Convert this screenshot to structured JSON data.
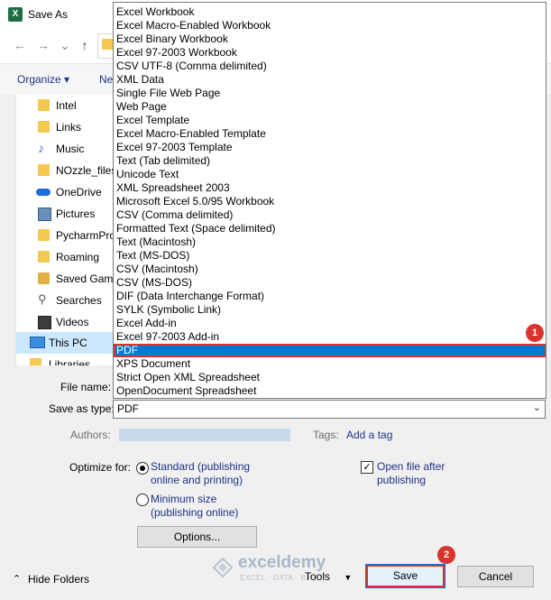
{
  "window": {
    "title": "Save As",
    "app_icon": "X"
  },
  "nav": {
    "back": "←",
    "forward": "→",
    "down": "⌄",
    "up": "↑"
  },
  "toolbar": {
    "organize": "Organize ▾",
    "new_folder": "Ne"
  },
  "sidebar": {
    "items": [
      {
        "label": "Intel",
        "icon": "folder-icon"
      },
      {
        "label": "Links",
        "icon": "link-icon"
      },
      {
        "label": "Music",
        "icon": "music-icon"
      },
      {
        "label": "NOzzle_files",
        "icon": "folder-icon"
      },
      {
        "label": "OneDrive",
        "icon": "cloud-icon"
      },
      {
        "label": "Pictures",
        "icon": "pictures-icon"
      },
      {
        "label": "PycharmPro",
        "icon": "folder-icon"
      },
      {
        "label": "Roaming",
        "icon": "folder-icon"
      },
      {
        "label": "Saved Game",
        "icon": "saved-games-icon"
      },
      {
        "label": "Searches",
        "icon": "search-icon"
      },
      {
        "label": "Videos",
        "icon": "video-icon"
      },
      {
        "label": "This PC",
        "icon": "computer-icon",
        "selected": true
      },
      {
        "label": "Libraries",
        "icon": "libraries-icon"
      }
    ]
  },
  "form": {
    "file_name_label": "File name:",
    "file_name_value": "",
    "save_as_type_label": "Save as type:",
    "save_as_type_value": "PDF",
    "authors_label": "Authors:",
    "tags_label": "Tags:",
    "tags_link": "Add a tag",
    "optimize_label": "Optimize for:",
    "opt_standard_1": "Standard (publishing",
    "opt_standard_2": "online and printing)",
    "opt_minimum_1": "Minimum size",
    "opt_minimum_2": "(publishing online)",
    "open_after_1": "Open file after",
    "open_after_2": "publishing",
    "options_button": "Options..."
  },
  "footer": {
    "hide_folders": "Hide Folders",
    "tools": "Tools",
    "save": "Save",
    "cancel": "Cancel"
  },
  "watermark": {
    "name": "exceldemy",
    "tagline": "EXCEL · DATA · BI"
  },
  "dropdown": {
    "items": [
      "Excel Workbook",
      "Excel Macro-Enabled Workbook",
      "Excel Binary Workbook",
      "Excel 97-2003 Workbook",
      "CSV UTF-8 (Comma delimited)",
      "XML Data",
      "Single File Web Page",
      "Web Page",
      "Excel Template",
      "Excel Macro-Enabled Template",
      "Excel 97-2003 Template",
      "Text (Tab delimited)",
      "Unicode Text",
      "XML Spreadsheet 2003",
      "Microsoft Excel 5.0/95 Workbook",
      "CSV (Comma delimited)",
      "Formatted Text (Space delimited)",
      "Text (Macintosh)",
      "Text (MS-DOS)",
      "CSV (Macintosh)",
      "CSV (MS-DOS)",
      "DIF (Data Interchange Format)",
      "SYLK (Symbolic Link)",
      "Excel Add-in",
      "Excel 97-2003 Add-in",
      "PDF",
      "XPS Document",
      "Strict Open XML Spreadsheet",
      "OpenDocument Spreadsheet"
    ],
    "selected_index": 25
  },
  "badges": {
    "one": "1",
    "two": "2"
  },
  "colors": {
    "accent": "#0078d7",
    "annotation": "#d9342b",
    "link": "#1e3287",
    "selection": "#cce8ff"
  }
}
